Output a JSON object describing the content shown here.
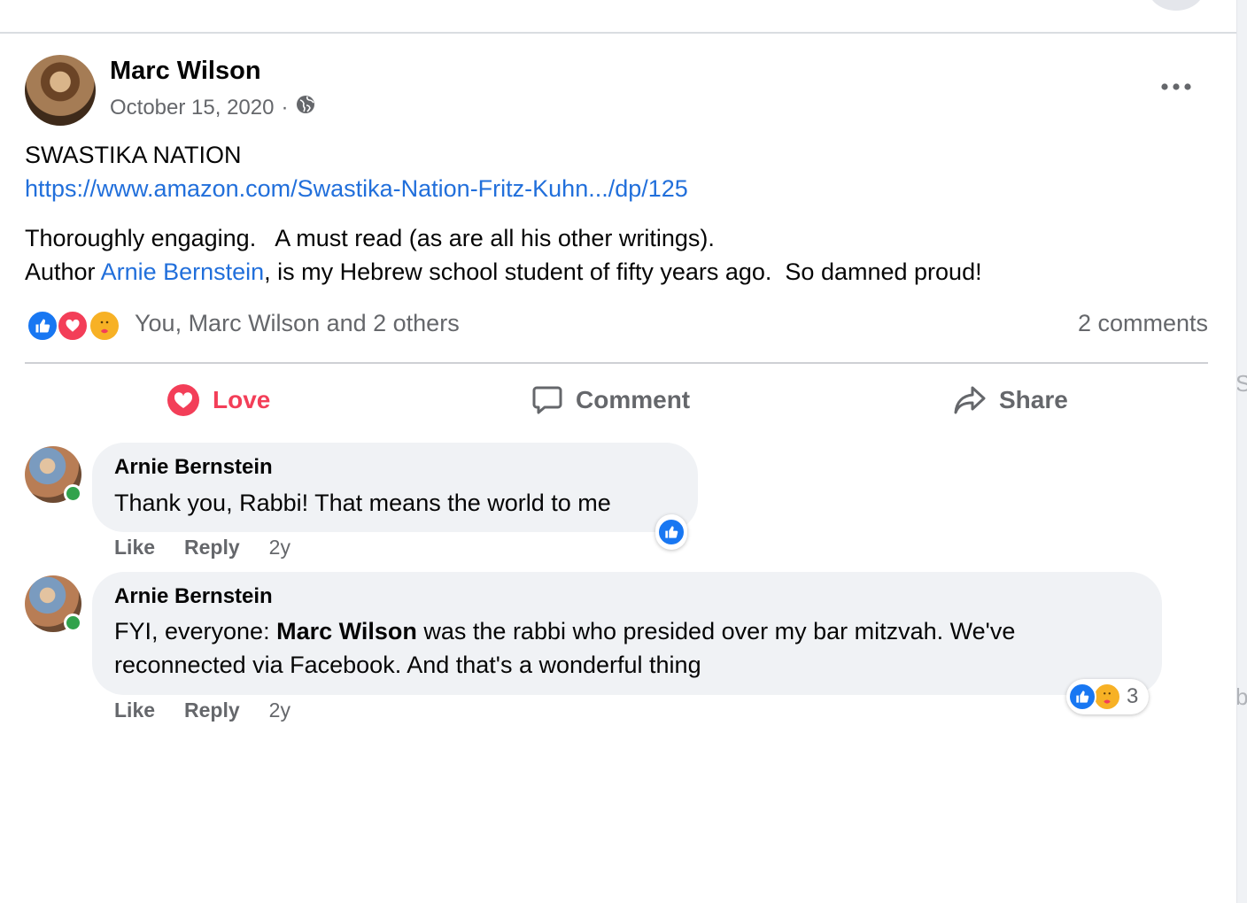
{
  "post": {
    "author": "Marc Wilson",
    "date": "October 15, 2020",
    "separator": "·",
    "title": "SWASTIKA NATION",
    "link": "https://www.amazon.com/Swastika-Nation-Fritz-Kuhn.../dp/125",
    "line1": "Thoroughly engaging.   A must read (as are all his other writings).",
    "line2_prefix": "Author ",
    "line2_mention": "Arnie Bernstein",
    "line2_suffix": ", is my Hebrew school student of fifty years ago.  So damned proud!"
  },
  "reactions": {
    "icons": [
      "like-icon",
      "love-icon",
      "care-icon"
    ],
    "names": "You, Marc Wilson and 2 others",
    "comments_count": "2 comments"
  },
  "actions": {
    "love": "Love",
    "comment": "Comment",
    "share": "Share"
  },
  "comments": [
    {
      "author": "Arnie Bernstein",
      "text": "Thank you, Rabbi! That means the world to me",
      "like": "Like",
      "reply": "Reply",
      "time": "2y",
      "reactions": [
        "like-icon"
      ]
    },
    {
      "author": "Arnie Bernstein",
      "text_prefix": "FYI, everyone: ",
      "text_mention": "Marc Wilson",
      "text_suffix": " was the rabbi who presided over my bar mitzvah. We've reconnected via Facebook. And that's a wonderful thing",
      "like": "Like",
      "reply": "Reply",
      "time": "2y",
      "reactions": [
        "like-icon",
        "care-icon"
      ],
      "reaction_count": "3"
    }
  ],
  "side": {
    "glyph1": "S",
    "glyph2": "b"
  },
  "colors": {
    "link": "#216fdb",
    "love": "#f33e58",
    "like": "#1877f2",
    "care": "#f7b125",
    "bubble": "#f0f2f5",
    "muted": "#65676b",
    "online": "#31a24c"
  }
}
